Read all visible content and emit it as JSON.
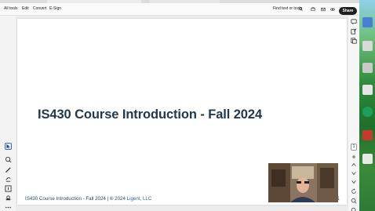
{
  "menubar": {
    "items": [
      "All tools",
      "Edit",
      "Convert",
      "E-Sign"
    ],
    "find_label": "Find text or tools",
    "share_label": "Share"
  },
  "slide": {
    "title": "IS430 Course Introduction - Fall 2024",
    "footer_prefix": "IS430 Course Introduction - Fall 2024 | ",
    "footer_copyright": "©",
    "footer_year": " 2024 ",
    "footer_company": "Ligent, LLC",
    "page_number": "1"
  },
  "right_panel": {
    "page_box": "1"
  },
  "colors": {
    "title": "#21384f",
    "link": "#2c5fa3",
    "share_bg": "#1f1f1f",
    "active_tool": "#3b6fd8"
  },
  "icons": {
    "left_rail": [
      "cursor-icon",
      "zoom-search-icon",
      "pen-icon",
      "eraser-icon",
      "text-select-icon",
      "stamp-icon",
      "more-icon"
    ],
    "right_rail": [
      "comment-icon",
      "export-icon",
      "pages-icon"
    ]
  }
}
